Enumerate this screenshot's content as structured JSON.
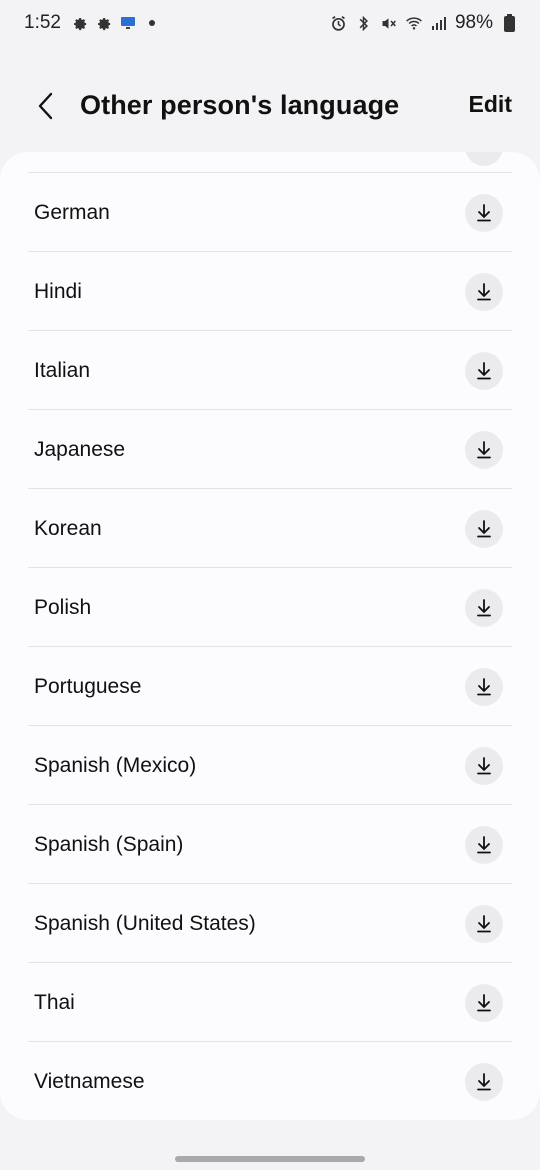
{
  "status_bar": {
    "time": "1:52",
    "battery_percent": "98%",
    "left_icons": [
      "gear-icon",
      "gear-icon",
      "monitor-icon",
      "dot-icon"
    ],
    "right_icons": [
      "alarm-icon",
      "bluetooth-icon",
      "mute-icon",
      "wifi-icon",
      "signal-icon",
      "battery-icon"
    ]
  },
  "header": {
    "title": "Other person's language",
    "edit_label": "Edit",
    "back_icon": "back-arrow-icon"
  },
  "languages": [
    {
      "label": "German",
      "action_icon": "download-icon"
    },
    {
      "label": "Hindi",
      "action_icon": "download-icon"
    },
    {
      "label": "Italian",
      "action_icon": "download-icon"
    },
    {
      "label": "Japanese",
      "action_icon": "download-icon"
    },
    {
      "label": "Korean",
      "action_icon": "download-icon"
    },
    {
      "label": "Polish",
      "action_icon": "download-icon"
    },
    {
      "label": "Portuguese",
      "action_icon": "download-icon"
    },
    {
      "label": "Spanish (Mexico)",
      "action_icon": "download-icon"
    },
    {
      "label": "Spanish (Spain)",
      "action_icon": "download-icon"
    },
    {
      "label": "Spanish (United States)",
      "action_icon": "download-icon"
    },
    {
      "label": "Thai",
      "action_icon": "download-icon"
    },
    {
      "label": "Vietnamese",
      "action_icon": "download-icon"
    }
  ],
  "colors": {
    "background": "#f3f3f5",
    "card": "#fcfcfe",
    "divider": "#e3e3e6",
    "icon_button": "#ebebed",
    "text": "#111111"
  }
}
